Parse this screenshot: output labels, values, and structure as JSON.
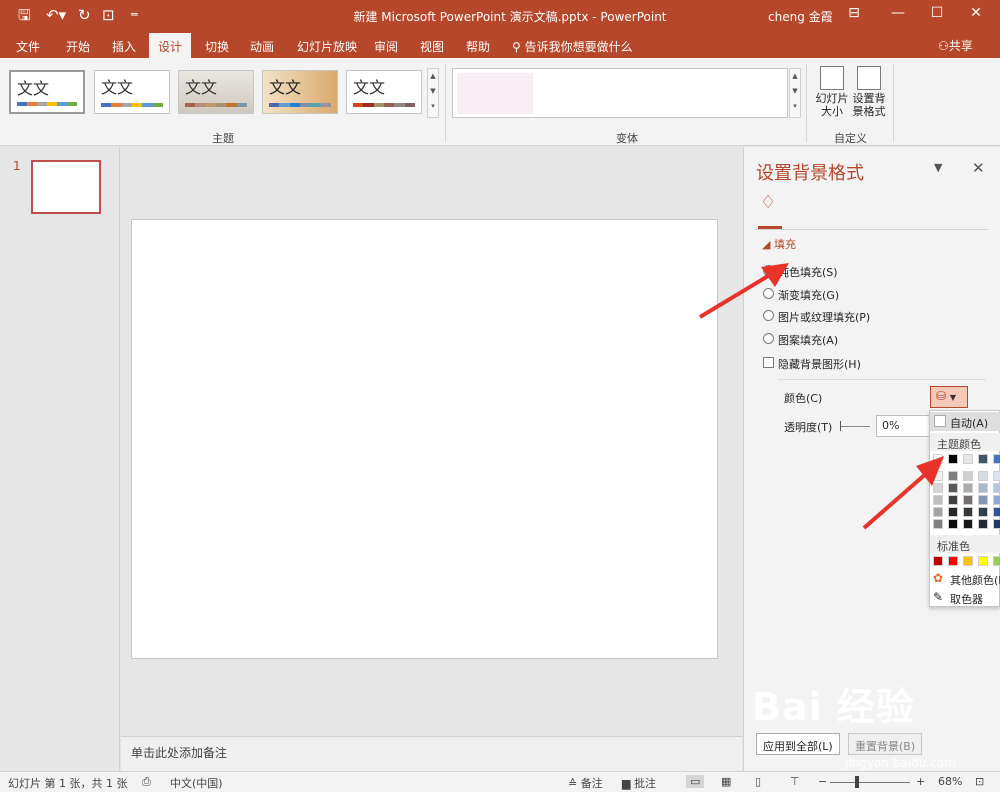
{
  "window": {
    "doc_title": "新建 Microsoft PowerPoint 演示文稿.pptx  -  PowerPoint",
    "user": "cheng 金霞"
  },
  "tabs": [
    {
      "label": "文件"
    },
    {
      "label": "开始"
    },
    {
      "label": "插入"
    },
    {
      "label": "设计"
    },
    {
      "label": "切换"
    },
    {
      "label": "动画"
    },
    {
      "label": "幻灯片放映"
    },
    {
      "label": "审阅"
    },
    {
      "label": "视图"
    },
    {
      "label": "帮助"
    }
  ],
  "tell_me": "告诉我你想要做什么",
  "share": "共享",
  "ribbon": {
    "themes_label": "主题",
    "theme_sample": "文文",
    "variants_label": "变体",
    "customize_label": "自定义",
    "slide_size": "幻灯片\n大小",
    "bg_format": "设置背\n景格式"
  },
  "slide_panel": {
    "number": "1"
  },
  "notes": "单击此处添加备注",
  "format_pane": {
    "title": "设置背景格式",
    "fill_section": "填充",
    "options": [
      "纯色填充(S)",
      "渐变填充(G)",
      "图片或纹理填充(P)",
      "图案填充(A)"
    ],
    "selected_option": 0,
    "hide_bg": "隐藏背景图形(H)",
    "color_label": "颜色(C)",
    "transparency_label": "透明度(T)",
    "transparency_value": "0%",
    "apply_all": "应用到全部(L)",
    "reset_bg": "重置背景(B)"
  },
  "color_popup": {
    "auto": "自动(A)",
    "theme_colors": "主题颜色",
    "standard_colors": "标准色",
    "more_colors": "其他颜色(M)...",
    "eyedropper": "取色器",
    "theme_top": [
      "#ffffff",
      "#000000",
      "#e7e6e6",
      "#44546a",
      "#4472c4"
    ],
    "theme_shades": [
      [
        "#f2f2f2",
        "#7f7f7f",
        "#d0cece",
        "#d6dce4",
        "#d9e2f3"
      ],
      [
        "#d8d8d8",
        "#595959",
        "#aeabab",
        "#adb9ca",
        "#b4c6e7"
      ],
      [
        "#bfbfbf",
        "#3f3f3f",
        "#757070",
        "#8496b0",
        "#8eaadb"
      ],
      [
        "#a5a5a5",
        "#262626",
        "#3a3838",
        "#323f4f",
        "#2f5496"
      ],
      [
        "#7f7f7f",
        "#0c0c0c",
        "#171616",
        "#222a35",
        "#1f3864"
      ]
    ],
    "standard": [
      "#c00000",
      "#ff0000",
      "#ffc000",
      "#ffff00",
      "#92d050"
    ]
  },
  "status": {
    "slide_info": "幻灯片 第 1 张，共 1 张",
    "language": "中文(中国)",
    "notes": "备注",
    "comments": "批注",
    "zoom": "68%"
  },
  "watermark": {
    "brand": "Bai 经验",
    "url": "jingyan.baidu.com"
  },
  "colors": {
    "accent": "#b7472a"
  }
}
